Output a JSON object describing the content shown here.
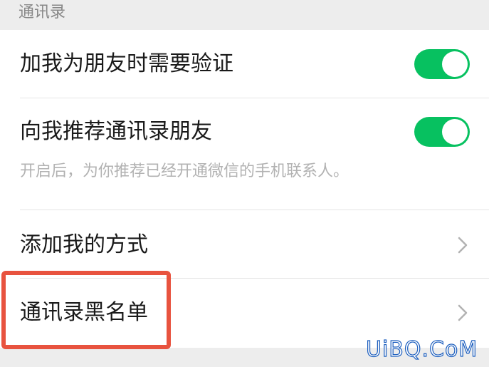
{
  "section": {
    "header": "通讯录"
  },
  "settings": [
    {
      "label": "加我为朋友时需要验证",
      "control": "toggle",
      "state": "on"
    },
    {
      "label": "向我推荐通讯录朋友",
      "description": "开启后，为你推荐已经开通微信的手机联系人。",
      "control": "toggle",
      "state": "on"
    },
    {
      "label": "添加我的方式",
      "control": "chevron-right-icon"
    },
    {
      "label": "通讯录黑名单",
      "control": "chevron-right-icon",
      "highlighted": true
    }
  ],
  "colors": {
    "toggle_on": "#07c160",
    "highlight": "#e8533f",
    "background": "#ededed"
  },
  "watermark": "UiBQ.CoM"
}
